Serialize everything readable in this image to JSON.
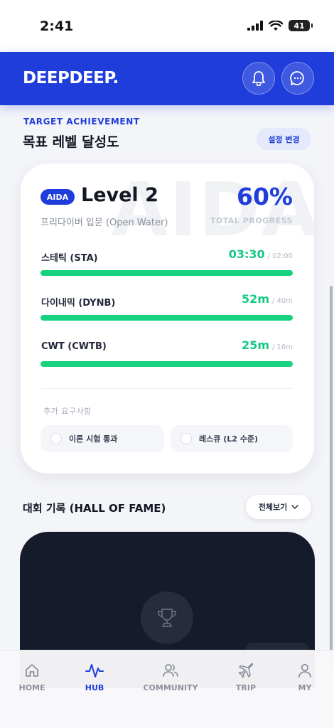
{
  "status": {
    "time": "2:41",
    "battery": "41"
  },
  "header": {
    "logo": "DEEPDEEP."
  },
  "section": {
    "kicker": "TARGET ACHIEVEMENT",
    "title": "목표 레벨 달성도",
    "change_label": "설정 변경"
  },
  "card": {
    "watermark": "AIDA",
    "badge": "AIDA",
    "level": "Level 2",
    "subtitle": "프리다이버 입문 (Open Water)",
    "percent": "60%",
    "percent_label": "TOTAL PROGRESS",
    "metrics": [
      {
        "label": "스테틱 (STA)",
        "current": "03:30",
        "target": "/ 02:00",
        "fill": 1.0
      },
      {
        "label": "다이내믹 (DYNB)",
        "current": "52m",
        "target": "/ 40m",
        "fill": 1.0
      },
      {
        "label": "CWT (CWTB)",
        "current": "25m",
        "target": "/ 16m",
        "fill": 1.0
      }
    ],
    "extra_label": "추가 요구사항",
    "requirements": [
      "이론 시험 통과",
      "레스큐 (L2 수준)"
    ]
  },
  "hall_of_fame": {
    "title": "대회 기록 (HALL OF FAME)",
    "view_all": "전체보기"
  },
  "nav": [
    {
      "label": "HOME",
      "icon": "home-icon",
      "active": false
    },
    {
      "label": "HUB",
      "icon": "activity-icon",
      "active": true
    },
    {
      "label": "COMMUNITY",
      "icon": "users-icon",
      "active": false
    },
    {
      "label": "TRIP",
      "icon": "plane-icon",
      "active": false
    },
    {
      "label": "MY",
      "icon": "user-icon",
      "active": false
    }
  ],
  "colors": {
    "brand": "#1e3ddb",
    "success": "#18d27f",
    "dark_card": "#161b2b"
  }
}
